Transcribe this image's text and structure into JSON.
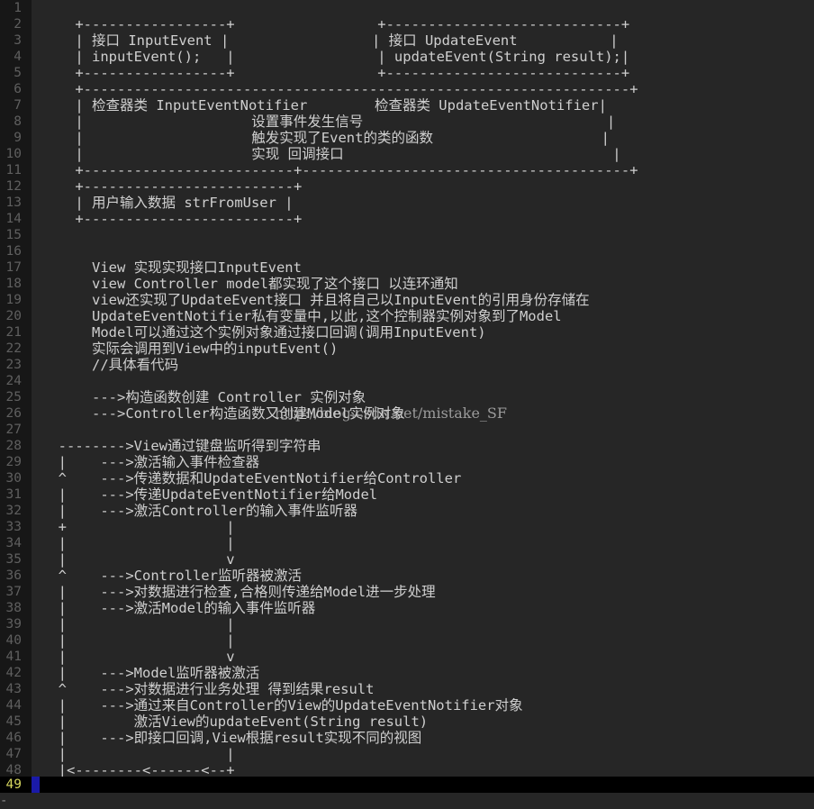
{
  "editor": {
    "lines": [
      {
        "num": "1",
        "text": ""
      },
      {
        "num": "2",
        "text": "    +-----------------+                 +----------------------------+"
      },
      {
        "num": "3",
        "text": "    | 接口 InputEvent |                 | 接口 UpdateEvent           |"
      },
      {
        "num": "4",
        "text": "    | inputEvent();   |                 | updateEvent(String result);|"
      },
      {
        "num": "5",
        "text": "    +-----------------+                 +----------------------------+"
      },
      {
        "num": "6",
        "text": "    +-----------------------------------------------------------------+"
      },
      {
        "num": "7",
        "text": "    | 检查器类 InputEventNotifier        检查器类 UpdateEventNotifier|"
      },
      {
        "num": "8",
        "text": "    |                    设置事件发生信号                             |"
      },
      {
        "num": "9",
        "text": "    |                    触发实现了Event的类的函数                    |"
      },
      {
        "num": "10",
        "text": "    |                    实现 回调接口                                |"
      },
      {
        "num": "11",
        "text": "    +-------------------------+---------------------------------------+"
      },
      {
        "num": "12",
        "text": "    +-------------------------+"
      },
      {
        "num": "13",
        "text": "    | 用户输入数据 strFromUser |"
      },
      {
        "num": "14",
        "text": "    +-------------------------+"
      },
      {
        "num": "15",
        "text": ""
      },
      {
        "num": "16",
        "text": ""
      },
      {
        "num": "17",
        "text": "      View 实现实现接口InputEvent"
      },
      {
        "num": "18",
        "text": "      view Controller model都实现了这个接口 以连环通知"
      },
      {
        "num": "19",
        "text": "      view还实现了UpdateEvent接口 并且将自己以InputEvent的引用身份存储在"
      },
      {
        "num": "20",
        "text": "      UpdateEventNotifier私有变量中,以此,这个控制器实例对象到了Model"
      },
      {
        "num": "21",
        "text": "      Model可以通过这个实例对象通过接口回调(调用InputEvent)"
      },
      {
        "num": "22",
        "text": "      实际会调用到View中的inputEvent()"
      },
      {
        "num": "23",
        "text": "      //具体看代码"
      },
      {
        "num": "24",
        "text": ""
      },
      {
        "num": "25",
        "text": "      --->构造函数创建 Controller 实例对象"
      },
      {
        "num": "26",
        "text": "      --->Controller构造函数又创建Model实例对象"
      },
      {
        "num": "27",
        "text": ""
      },
      {
        "num": "28",
        "text": "  -------->View通过键盘监听得到字符串"
      },
      {
        "num": "29",
        "text": "  |    --->激活输入事件检查器"
      },
      {
        "num": "30",
        "text": "  ^    --->传递数据和UpdateEventNotifier给Controller"
      },
      {
        "num": "31",
        "text": "  |    --->传递UpdateEventNotifier给Model"
      },
      {
        "num": "32",
        "text": "  |    --->激活Controller的输入事件监听器"
      },
      {
        "num": "33",
        "text": "  +                   |"
      },
      {
        "num": "34",
        "text": "  |                   |"
      },
      {
        "num": "35",
        "text": "  |                   v"
      },
      {
        "num": "36",
        "text": "  ^    --->Controller监听器被激活"
      },
      {
        "num": "37",
        "text": "  |    --->对数据进行检查,合格则传递给Model进一步处理"
      },
      {
        "num": "38",
        "text": "  |    --->激活Model的输入事件监听器"
      },
      {
        "num": "39",
        "text": "  |                   |"
      },
      {
        "num": "40",
        "text": "  |                   |"
      },
      {
        "num": "41",
        "text": "  |                   v"
      },
      {
        "num": "42",
        "text": "  |    --->Model监听器被激活"
      },
      {
        "num": "43",
        "text": "  ^    --->对数据进行业务处理 得到结果result"
      },
      {
        "num": "44",
        "text": "  |    --->通过来自Controller的View的UpdateEventNotifier对象"
      },
      {
        "num": "45",
        "text": "  |        激活View的updateEvent(String result)"
      },
      {
        "num": "46",
        "text": "  |    --->即接口回调,View根据result实现不同的视图"
      },
      {
        "num": "47",
        "text": "  |                   |"
      },
      {
        "num": "48",
        "text": "  |<--------<------<--+"
      }
    ],
    "current_line_number": "49",
    "watermark": "http://blog.csdn.net/mistake_SF"
  },
  "statusbar": {
    "mark": "-"
  }
}
